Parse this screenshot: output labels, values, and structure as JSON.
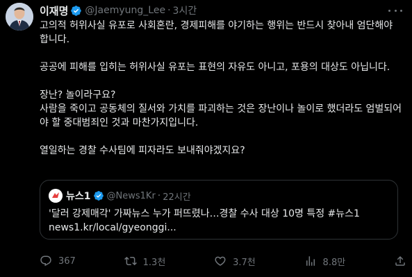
{
  "tweet": {
    "author_name": "이재명",
    "handle": "@Jaemyung_Lee",
    "separator": "·",
    "time": "3시간",
    "paragraphs": [
      "고의적 허위사실 유포로 사회혼란, 경제피해를 야기하는 행위는 반드시 찾아내 엄단해야 합니다.",
      "공공에 피해를 입히는 허위사실 유포는 표현의 자유도 아니고, 포용의 대상도 아닙니다.",
      "장난? 놀이라구요?",
      "사람을 죽이고 공동체의 질서와 가치를 파괴하는 것은 장난이나 놀이로 했더라도 엄벌되어야 할 중대범죄인 것과 마찬가지입니다.",
      "열일하는 경찰 수사팀에 피자라도 보내줘야겠지요?"
    ]
  },
  "quote": {
    "author_name": "뉴스1",
    "handle": "@News1Kr",
    "separator": "·",
    "time": "22시간",
    "avatar_text": "뉴스1",
    "text_line1": "'달러 강제매각' 가짜뉴스 누가 퍼뜨렸나…경찰 수사 대상 10명 특정 #뉴스1",
    "text_line2": "news1.kr/local/gyeonggi..."
  },
  "actions": {
    "replies": "367",
    "retweets": "1.3천",
    "likes": "3.7천",
    "views": "8.8만"
  },
  "icons": {
    "verified": "verified-badge-icon",
    "more": "more-icon",
    "reply": "reply-icon",
    "retweet": "retweet-icon",
    "like": "heart-icon",
    "views": "views-icon",
    "share": "share-icon"
  },
  "colors": {
    "background": "#000000",
    "text": "#e7e9ea",
    "muted": "#71767b",
    "verified": "#1d9bf0",
    "border": "#2f3336"
  }
}
